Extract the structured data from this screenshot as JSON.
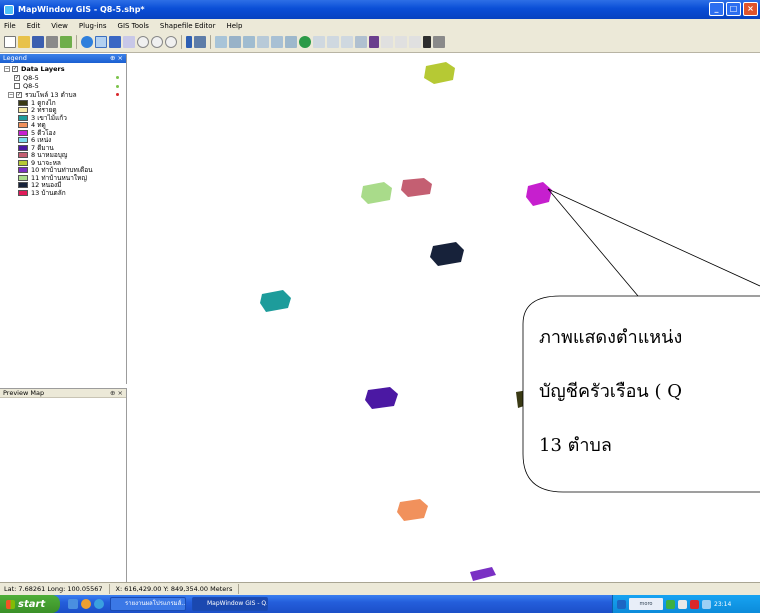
{
  "window": {
    "title": "MapWindow GIS - Q8-5.shp*",
    "minimize": "_",
    "maximize": "□",
    "close": "×"
  },
  "menu": [
    "File",
    "Edit",
    "View",
    "Plug-ins",
    "GIS Tools",
    "Shapefile Editor",
    "Help"
  ],
  "legend": {
    "title": "Legend",
    "pin": "⊕ ×",
    "group": "Data Layers",
    "layers": [
      {
        "name": "Q8-5",
        "checked": "✓",
        "dot_color": "#7cc34b"
      },
      {
        "name": "Q8-5",
        "checked": "",
        "dot_color": "#7cc34b"
      },
      {
        "name": "รวมโพล์ 13 ตำบล",
        "checked": "✓",
        "dot_color": "#d8272b"
      }
    ],
    "categories": [
      {
        "label": "1 ดูกงไก",
        "color": "#3a3a14"
      },
      {
        "label": "2 ทรายดู",
        "color": "#f5e9a3"
      },
      {
        "label": "3 เขาไม้แก้ว",
        "color": "#1d9c9b"
      },
      {
        "label": "4 ทดู",
        "color": "#f1915c"
      },
      {
        "label": "5 ดีวโอง",
        "color": "#c61fce"
      },
      {
        "label": "6 เหน่ง",
        "color": "#7bdcec"
      },
      {
        "label": "7 ดีมาน",
        "color": "#4b18a3"
      },
      {
        "label": "8 นาหมอบุญ",
        "color": "#c45f72"
      },
      {
        "label": "9 นาจะหล",
        "color": "#b6c934"
      },
      {
        "label": "10 ท่าบ้านท่าบทเดือน",
        "color": "#7a30c4"
      },
      {
        "label": "11 ท่าบ้านหนาใหญ่",
        "color": "#a9db8a"
      },
      {
        "label": "12 หนองมี",
        "color": "#17223a"
      },
      {
        "label": "13 บ้านตลัก",
        "color": "#e01a59"
      }
    ]
  },
  "preview": {
    "title": "Preview Map",
    "pin": "⊕ ×"
  },
  "map": {
    "callout": {
      "line1": "ภาพแสดงตำแหน่ง",
      "line2": "บัญชีครัวเรือน ( Q",
      "line3": "13 ตำบล"
    }
  },
  "status": {
    "latlong": "Lat: 7.68261  Long: 100.05567",
    "xy": "X: 616,429.00  Y: 849,354.00 Meters"
  },
  "taskbar": {
    "start": "start",
    "tasks": [
      {
        "label": "รายงานผลโปรแกรมส์..."
      },
      {
        "label": "MapWindow GIS - Q..."
      }
    ],
    "tray_ad": "moro",
    "clock": "23:14"
  }
}
